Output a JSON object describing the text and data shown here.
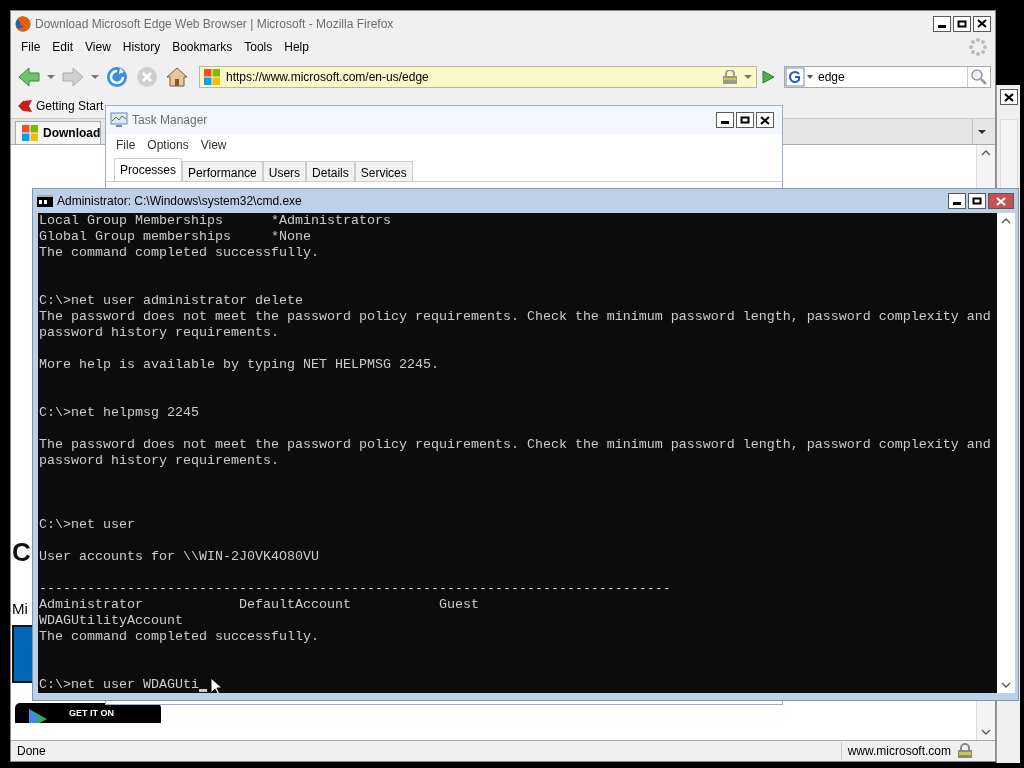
{
  "browser": {
    "title": "Download Microsoft Edge Web Browser | Microsoft - Mozilla Firefox",
    "menu": [
      "File",
      "Edit",
      "View",
      "History",
      "Bookmarks",
      "Tools",
      "Help"
    ],
    "nav_buttons": [
      {
        "kind": "back",
        "disabled": false
      },
      {
        "kind": "forward",
        "disabled": true
      },
      {
        "kind": "reload",
        "disabled": false
      },
      {
        "kind": "stop",
        "disabled": true
      },
      {
        "kind": "home",
        "disabled": false
      }
    ],
    "url": "https://www.microsoft.com/en-us/edge",
    "search": {
      "value": "edge"
    },
    "bookmarks": [
      {
        "label": "Getting Start"
      }
    ],
    "tabs": [
      {
        "label": "Download",
        "selected": true
      }
    ],
    "page": {
      "heading": "C",
      "text": "Mi",
      "badge": "GET IT ON"
    },
    "status_bar": {
      "text": "Done",
      "host": "www.microsoft.com"
    }
  },
  "task_manager": {
    "title": "Task Manager",
    "menu": [
      "File",
      "Options",
      "View"
    ],
    "tabs": [
      {
        "label": "Processes",
        "selected": true
      },
      {
        "label": "Performance",
        "selected": false
      },
      {
        "label": "Users",
        "selected": false
      },
      {
        "label": "Details",
        "selected": false
      },
      {
        "label": "Services",
        "selected": false
      }
    ]
  },
  "console": {
    "title": "Administrator: C:\\Windows\\system32\\cmd.exe",
    "lines": [
      {
        "kind": "text",
        "text": "Local Group Memberships      *Administrators"
      },
      {
        "kind": "text",
        "text": "Global Group memberships     *None"
      },
      {
        "kind": "text",
        "text": "The command completed successfully."
      },
      {
        "kind": "blank"
      },
      {
        "kind": "blank"
      },
      {
        "kind": "text",
        "text": "C:\\>net user administrator delete"
      },
      {
        "kind": "text",
        "text": "The password does not meet the password policy requirements. Check the minimum password length, password complexity and"
      },
      {
        "kind": "text",
        "text": "password history requirements."
      },
      {
        "kind": "blank"
      },
      {
        "kind": "text",
        "text": "More help is available by typing NET HELPMSG 2245."
      },
      {
        "kind": "blank"
      },
      {
        "kind": "blank"
      },
      {
        "kind": "text",
        "text": "C:\\>net helpmsg 2245"
      },
      {
        "kind": "blank"
      },
      {
        "kind": "text",
        "text": "The password does not meet the password policy requirements. Check the minimum password length, password complexity and"
      },
      {
        "kind": "text",
        "text": "password history requirements."
      },
      {
        "kind": "blank"
      },
      {
        "kind": "blank"
      },
      {
        "kind": "blank"
      },
      {
        "kind": "text",
        "text": "C:\\>net user"
      },
      {
        "kind": "blank"
      },
      {
        "kind": "text",
        "text": "User accounts for \\\\WIN-2J0VK4O80VU"
      },
      {
        "kind": "blank"
      },
      {
        "kind": "text",
        "text": "-------------------------------------------------------------------------------"
      },
      {
        "kind": "text",
        "text": "Administrator            DefaultAccount           Guest"
      },
      {
        "kind": "text",
        "text": "WDAGUtilityAccount"
      },
      {
        "kind": "text",
        "text": "The command completed successfully."
      },
      {
        "kind": "blank"
      },
      {
        "kind": "blank"
      },
      {
        "kind": "input",
        "text": "C:\\>net user WDAGUti"
      }
    ]
  }
}
